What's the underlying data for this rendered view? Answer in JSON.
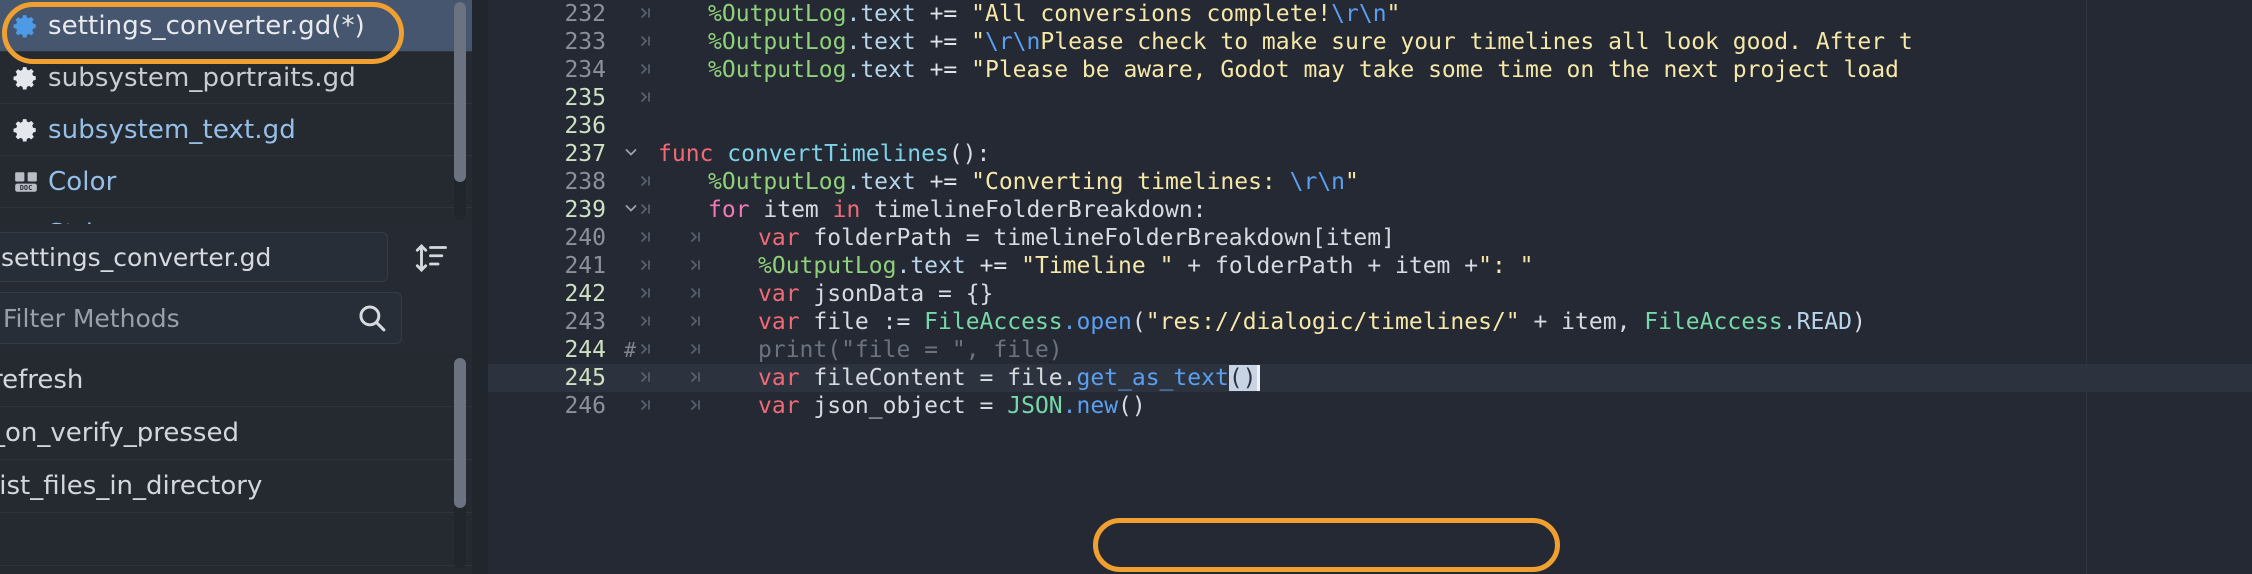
{
  "sidebar": {
    "script_list": [
      {
        "icon": "gear-icon",
        "label": "settings_converter.gd(*)",
        "color": "white",
        "selected": true
      },
      {
        "icon": "gear-icon",
        "label": "subsystem_portraits.gd",
        "color": "grey",
        "selected": false
      },
      {
        "icon": "gear-icon",
        "label": "subsystem_text.gd",
        "color": "blue",
        "selected": false
      },
      {
        "icon": "doc-book-icon",
        "label": "Color",
        "color": "blue",
        "selected": false
      },
      {
        "icon": "doc-book-icon",
        "label": "String",
        "color": "blue",
        "selected": false
      }
    ],
    "script_name_field": {
      "value": "settings_converter.gd",
      "sort_icon": "sort-icon"
    },
    "filter": {
      "placeholder": "Filter Methods",
      "value": "",
      "search_icon": "search-icon"
    },
    "methods": [
      {
        "label": "refresh"
      },
      {
        "label": "_on_verify_pressed"
      },
      {
        "label": "list_files_in_directory"
      },
      {
        "label": ""
      }
    ]
  },
  "editor": {
    "lines": [
      {
        "number": "232",
        "number_mark": false,
        "fold": "",
        "hash": false,
        "tabs": 1,
        "current": false,
        "tokens": [
          {
            "t": "%OutputLog",
            "c": "t-node"
          },
          {
            "t": ".text",
            "c": "t-prop"
          },
          {
            "t": " += ",
            "c": "t-op"
          },
          {
            "t": "\"All conversions complete!",
            "c": "t-str"
          },
          {
            "t": "\\r\\n",
            "c": "t-esc"
          },
          {
            "t": "\"",
            "c": "t-str"
          }
        ]
      },
      {
        "number": "233",
        "number_mark": false,
        "fold": "",
        "hash": false,
        "tabs": 1,
        "current": false,
        "tokens": [
          {
            "t": "%OutputLog",
            "c": "t-node"
          },
          {
            "t": ".text",
            "c": "t-prop"
          },
          {
            "t": " += ",
            "c": "t-op"
          },
          {
            "t": "\"",
            "c": "t-str"
          },
          {
            "t": "\\r\\n",
            "c": "t-esc"
          },
          {
            "t": "Please check to make sure your timelines all look good. After t",
            "c": "t-str"
          }
        ]
      },
      {
        "number": "234",
        "number_mark": false,
        "fold": "",
        "hash": false,
        "tabs": 1,
        "current": false,
        "tokens": [
          {
            "t": "%OutputLog",
            "c": "t-node"
          },
          {
            "t": ".text",
            "c": "t-prop"
          },
          {
            "t": " += ",
            "c": "t-op"
          },
          {
            "t": "\"Please be aware, Godot may take some time on the next project load",
            "c": "t-str"
          }
        ]
      },
      {
        "number": "235",
        "number_mark": true,
        "fold": "",
        "hash": false,
        "tabs": 1,
        "current": false,
        "tokens": []
      },
      {
        "number": "236",
        "number_mark": true,
        "fold": "",
        "hash": false,
        "tabs": 0,
        "current": false,
        "tokens": []
      },
      {
        "number": "237",
        "number_mark": true,
        "fold": "v",
        "hash": false,
        "tabs": 0,
        "current": false,
        "tokens": [
          {
            "t": "func ",
            "c": "t-kw"
          },
          {
            "t": "convertTimelines",
            "c": "t-fn"
          },
          {
            "t": "():",
            "c": "t-punct"
          }
        ]
      },
      {
        "number": "238",
        "number_mark": false,
        "fold": "",
        "hash": false,
        "tabs": 1,
        "current": false,
        "tokens": [
          {
            "t": "%OutputLog",
            "c": "t-node"
          },
          {
            "t": ".text",
            "c": "t-prop"
          },
          {
            "t": " += ",
            "c": "t-op"
          },
          {
            "t": "\"Converting timelines: ",
            "c": "t-str"
          },
          {
            "t": "\\r\\n",
            "c": "t-esc"
          },
          {
            "t": "\"",
            "c": "t-str"
          }
        ]
      },
      {
        "number": "239",
        "number_mark": true,
        "fold": "v",
        "hash": false,
        "tabs": 1,
        "current": false,
        "tokens": [
          {
            "t": "for ",
            "c": "t-kw2"
          },
          {
            "t": "item ",
            "c": "t-ident"
          },
          {
            "t": "in ",
            "c": "t-kw"
          },
          {
            "t": "timelineFolderBreakdown:",
            "c": "t-ident"
          }
        ]
      },
      {
        "number": "240",
        "number_mark": false,
        "fold": "",
        "hash": false,
        "tabs": 2,
        "current": false,
        "tokens": [
          {
            "t": "var ",
            "c": "t-kw"
          },
          {
            "t": "folderPath = timelineFolderBreakdown[item]",
            "c": "t-ident"
          }
        ]
      },
      {
        "number": "241",
        "number_mark": false,
        "fold": "",
        "hash": false,
        "tabs": 2,
        "current": false,
        "tokens": [
          {
            "t": "%OutputLog",
            "c": "t-node"
          },
          {
            "t": ".text",
            "c": "t-prop"
          },
          {
            "t": " += ",
            "c": "t-op"
          },
          {
            "t": "\"Timeline \"",
            "c": "t-str"
          },
          {
            "t": " + folderPath + item +",
            "c": "t-ident"
          },
          {
            "t": "\": \"",
            "c": "t-str"
          }
        ]
      },
      {
        "number": "242",
        "number_mark": true,
        "fold": "",
        "hash": false,
        "tabs": 2,
        "current": false,
        "tokens": [
          {
            "t": "var ",
            "c": "t-kw"
          },
          {
            "t": "jsonData = {}",
            "c": "t-ident"
          }
        ]
      },
      {
        "number": "243",
        "number_mark": false,
        "fold": "",
        "hash": false,
        "tabs": 2,
        "current": false,
        "tokens": [
          {
            "t": "var ",
            "c": "t-kw"
          },
          {
            "t": "file := ",
            "c": "t-ident"
          },
          {
            "t": "FileAccess",
            "c": "t-class"
          },
          {
            "t": ".open",
            "c": "t-method"
          },
          {
            "t": "(",
            "c": "t-punct"
          },
          {
            "t": "\"res://dialogic/timelines/\"",
            "c": "t-str"
          },
          {
            "t": " + item, ",
            "c": "t-ident"
          },
          {
            "t": "FileAccess",
            "c": "t-class"
          },
          {
            "t": ".READ",
            "c": "t-prop"
          },
          {
            "t": ")",
            "c": "t-punct"
          }
        ]
      },
      {
        "number": "244",
        "number_mark": true,
        "fold": "",
        "hash": true,
        "tabs": 2,
        "current": false,
        "tokens": [
          {
            "t": "print(\"file = \", file)",
            "c": "t-comment"
          }
        ]
      },
      {
        "number": "245",
        "number_mark": true,
        "fold": "",
        "hash": false,
        "tabs": 2,
        "current": true,
        "tokens": [
          {
            "t": "var ",
            "c": "t-kw"
          },
          {
            "t": "fileContent = file.",
            "c": "t-ident"
          },
          {
            "t": "get_as_text",
            "c": "t-method"
          },
          {
            "t": "()",
            "c": "sel"
          }
        ]
      },
      {
        "number": "246",
        "number_mark": false,
        "fold": "",
        "hash": false,
        "tabs": 2,
        "current": false,
        "tokens": [
          {
            "t": "var ",
            "c": "t-kw"
          },
          {
            "t": "json_object = ",
            "c": "t-ident"
          },
          {
            "t": "JSON",
            "c": "t-class"
          },
          {
            "t": ".new",
            "c": "t-method"
          },
          {
            "t": "()",
            "c": "t-punct"
          }
        ]
      }
    ],
    "caret_visible": true
  },
  "annotations": {
    "highlight_color": "#f0a030",
    "regions": [
      {
        "name": "script-tab-highlight",
        "target": "settings_converter.gd(*)"
      },
      {
        "name": "code-line-highlight",
        "target": "var fileContent = file.get_as_text()"
      }
    ]
  }
}
